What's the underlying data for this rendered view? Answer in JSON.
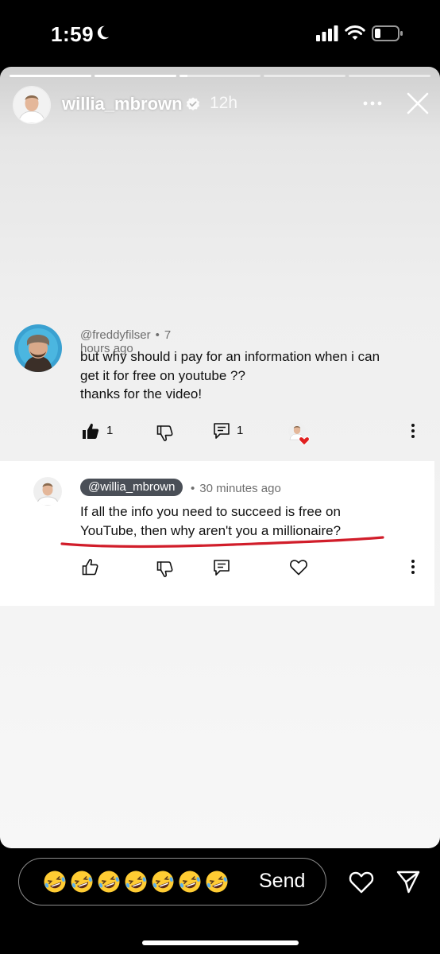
{
  "status_bar": {
    "time": "1:59",
    "icons": [
      "moon-icon",
      "cellular-signal-icon",
      "wifi-icon",
      "battery-icon"
    ]
  },
  "story": {
    "progress_segments": [
      1,
      1,
      0.1,
      0,
      0
    ],
    "username": "willia_mbrown",
    "verified": true,
    "time_ago": "12h",
    "icons": [
      "more-options-icon",
      "close-icon"
    ]
  },
  "comment": {
    "author": "@freddyfilser",
    "separator": "•",
    "time_ago": "7 hours ago",
    "lines": [
      "but why should i pay for an information when i can",
      "get it for free on youtube ??",
      "thanks for the video!"
    ],
    "like_count": "1",
    "reply_count": "1",
    "icons": [
      "thumbs-up-filled-icon",
      "thumbs-down-icon",
      "reply-icon",
      "creator-heart-icon",
      "more-vertical-icon"
    ]
  },
  "reply": {
    "author": "@willia_mbrown",
    "separator": "•",
    "time_ago": "30 minutes ago",
    "lines": [
      "If all the info you need to succeed is free on",
      "YouTube, then why aren't you a millionaire?"
    ],
    "underline_color": "#d11d2a",
    "icons": [
      "thumbs-up-icon",
      "thumbs-down-icon",
      "reply-icon",
      "heart-icon",
      "more-vertical-icon"
    ]
  },
  "reply_bar": {
    "quick_reactions": [
      "🤣",
      "🤣",
      "🤣",
      "🤣",
      "🤣",
      "🤣",
      "🤣"
    ],
    "send_label": "Send",
    "icons": [
      "heart-icon",
      "direct-message-icon"
    ]
  }
}
